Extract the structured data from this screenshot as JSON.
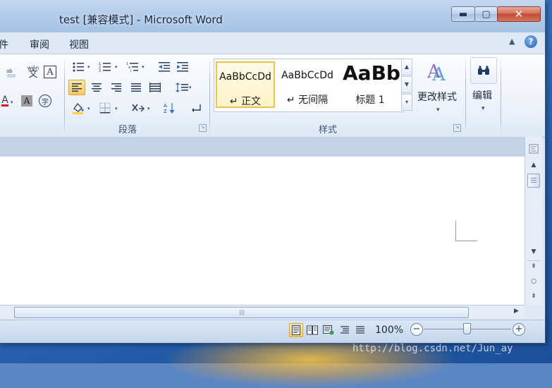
{
  "window": {
    "title": "test [兼容模式] - Microsoft Word",
    "controls": {
      "minimize": "▬",
      "maximize": "▢",
      "close": "✕"
    }
  },
  "tabs": [
    {
      "label": "件"
    },
    {
      "label": "审阅"
    },
    {
      "label": "视图"
    }
  ],
  "tab_bar": {
    "collapse": "▲",
    "help": "?"
  },
  "ribbon": {
    "groups": {
      "paragraph": {
        "label": "段落",
        "launcher": "↘"
      },
      "styles": {
        "label": "样式",
        "launcher": "↘"
      }
    },
    "font_partial": {
      "phonetic_label": "wén",
      "phonetic_char": "文",
      "char_border": "A",
      "font_color_letter": "A",
      "char_shading": "A",
      "enclose_char": "字"
    },
    "styles_gallery": [
      {
        "sample": "AaBbCcDd",
        "name": "↵ 正文",
        "selected": true
      },
      {
        "sample": "AaBbCcDd",
        "name": "↵ 无间隔",
        "selected": false
      },
      {
        "sample": "AaBb",
        "name": "标题 1",
        "selected": false
      }
    ],
    "change_styles": {
      "label": "更改样式",
      "dropdown": "▾"
    },
    "editing": {
      "label": "编辑",
      "dropdown": "▾"
    }
  },
  "status_bar": {
    "zoom_percent": "100%",
    "zoom_minus": "−",
    "zoom_plus": "+"
  },
  "watermark": "http://blog.csdn.net/Jun_ay",
  "colors": {
    "accent_highlight": "#ffc95c",
    "font_color_bar": "#e8101a",
    "close_button": "#c34a33"
  }
}
